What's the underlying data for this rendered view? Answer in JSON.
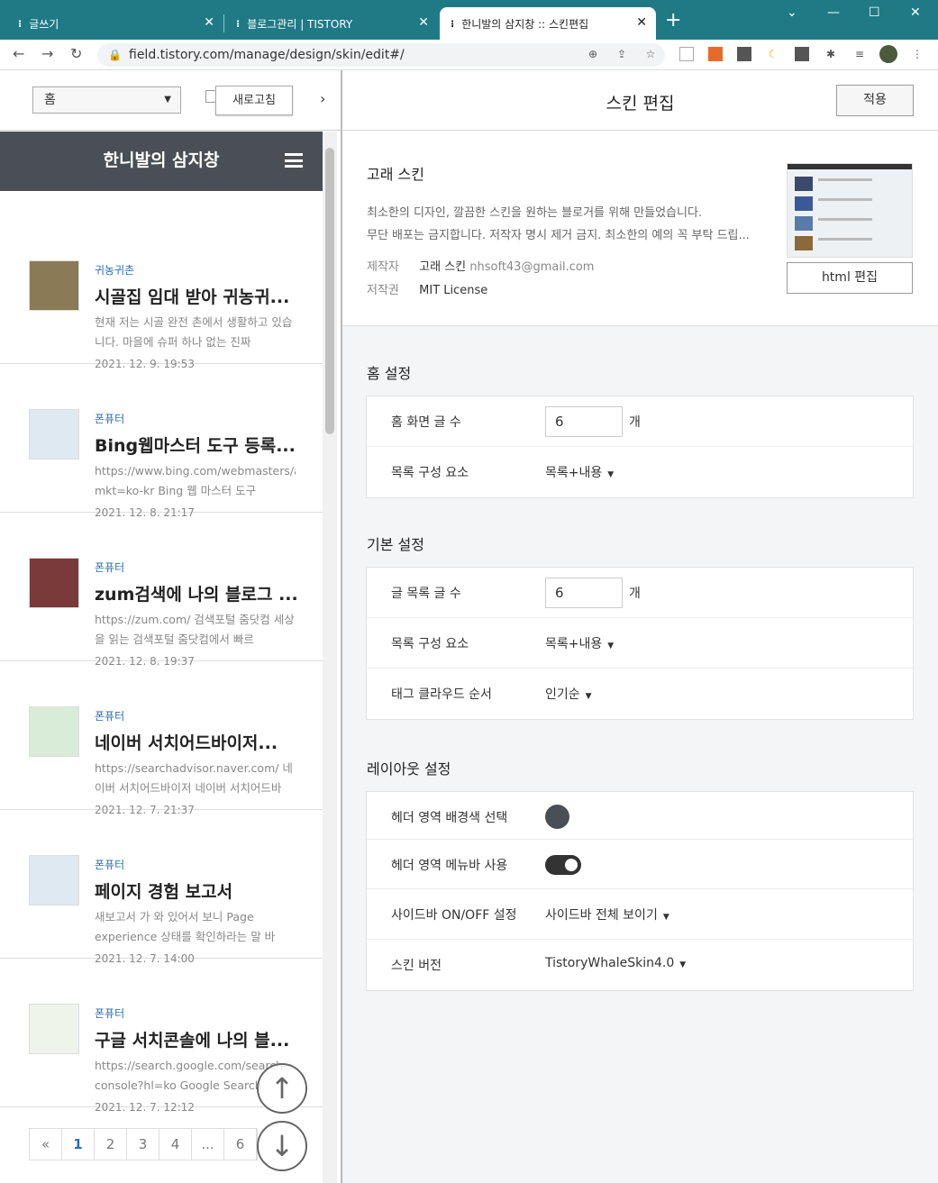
{
  "browser": {
    "tabs": [
      {
        "label": "글쓰기",
        "favicon": "T"
      },
      {
        "label": "블로그관리 | TISTORY",
        "favicon": "T"
      },
      {
        "label": "한니발의 삼지창 :: 스킨편집",
        "favicon": "T"
      }
    ],
    "url": "field.tistory.com/manage/design/skin/edit#/"
  },
  "preview": {
    "select_value": "홈",
    "refresh_label": "새로고침",
    "blog_title": "한니발의 삼지창",
    "posts": [
      {
        "category": "귀농귀촌",
        "title": "시골집 임대 받아 귀농귀...",
        "excerpt": "현재 저는 시골 완전 촌에서 생활하고 있습니다. 마을에 슈퍼 하나 없는 진짜",
        "date": "2021. 12. 9. 19:53"
      },
      {
        "category": "폰퓨터",
        "title": "Bing웹마스터 도구 등록...",
        "excerpt": "https://www.bing.com/webmasters/abo mkt=ko-kr Bing 웹 마스터 도구",
        "date": "2021. 12. 8. 21:17"
      },
      {
        "category": "폰퓨터",
        "title": "zum검색에 나의 블로그 ...",
        "excerpt": "https://zum.com/ 검색포털 줌닷컴 세상을 읽는 검색포털 줌닷컴에서 빠르",
        "date": "2021. 12. 8. 19:37"
      },
      {
        "category": "폰퓨터",
        "title": "네이버 서치어드바이저...",
        "excerpt": "https://searchadvisor.naver.com/ 네이버 서치어드바이저 네이버 서치어드바",
        "date": "2021. 12. 7. 21:37"
      },
      {
        "category": "폰퓨터",
        "title": "페이지 경험 보고서",
        "excerpt": "새보고서 가 와 있어서 보니 Page experience 상태를 확인하라는 말 바",
        "date": "2021. 12. 7. 14:00"
      },
      {
        "category": "폰퓨터",
        "title": "구글 서치콘솔에 나의 블...",
        "excerpt": "https://search.google.com/search-console?hl=ko Google Search",
        "date": "2021. 12. 7. 12:12"
      }
    ],
    "pagination": [
      "«",
      "1",
      "2",
      "3",
      "4",
      "...",
      "6"
    ]
  },
  "editor": {
    "title": "스킨 편집",
    "apply_label": "적용",
    "skin": {
      "name": "고래 스킨",
      "desc1": "최소한의 디자인, 깔끔한 스킨을 원하는 블로거를 위해 만들었습니다.",
      "desc2": "무단 배포는 금지합니다. 저작자 명시 제거 금지. 최소한의 예의 꼭 부탁 드립...",
      "author_label": "제작자",
      "author": "고래 스킨",
      "email": "nhsoft43@gmail.com",
      "license_label": "저작권",
      "license": "MIT License",
      "html_edit_label": "html 편집"
    },
    "home": {
      "title": "홈 설정",
      "count_label": "홈 화면 글 수",
      "count_value": "6",
      "unit": "개",
      "compose_label": "목록 구성 요소",
      "compose_value": "목록+내용"
    },
    "basic": {
      "title": "기본 설정",
      "count_label": "글 목록 글 수",
      "count_value": "6",
      "unit": "개",
      "compose_label": "목록 구성 요소",
      "compose_value": "목록+내용",
      "tag_label": "태그 클라우드 순서",
      "tag_value": "인기순"
    },
    "layout": {
      "title": "레이아웃 설정",
      "header_bg_label": "헤더 영역 배경색 선택",
      "header_bg_color": "#4a4f55",
      "menubar_label": "헤더 영역 메뉴바 사용",
      "menubar_on": true,
      "sidebar_label": "사이드바 ON/OFF 설정",
      "sidebar_value": "사이드바 전체 보이기",
      "version_label": "스킨 버전",
      "version_value": "TistoryWhaleSkin4.0"
    }
  }
}
